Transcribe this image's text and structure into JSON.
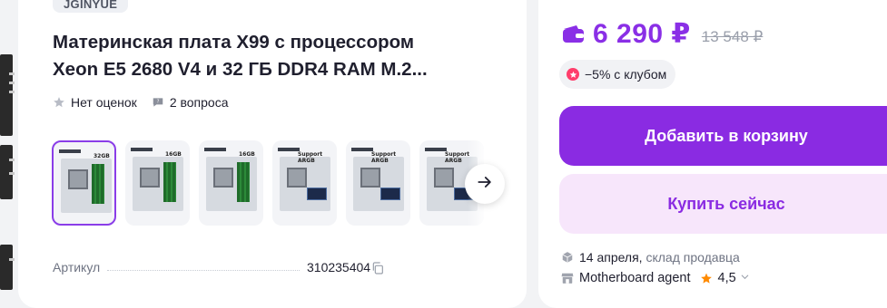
{
  "product": {
    "brand": "JGINYUE",
    "title_line1": "Материнская плата X99 с процессором",
    "title_line2": "Xeon E5 2680 V4 и 32 ГБ DDR4 RAM M.2...",
    "rating_text": "Нет оценок",
    "questions_text": "2 вопроса",
    "thumbnails": [
      {
        "label": "32GB"
      },
      {
        "label": "16GB"
      },
      {
        "label": "16GB"
      },
      {
        "label": "Support ARGB"
      },
      {
        "label": "Support ARGB"
      },
      {
        "label": "Support ARGB"
      }
    ],
    "spec": {
      "key": "Артикул",
      "value": "310235404"
    }
  },
  "pricing": {
    "price": "6 290 ₽",
    "old_price": "13 548 ₽",
    "club_discount": "−5% с клубом",
    "add_to_cart": "Добавить в корзину",
    "buy_now": "Купить сейчас",
    "delivery_date": "14 апреля,",
    "delivery_source": "склад продавца",
    "seller_name": "Motherboard agent",
    "seller_rating": "4,5"
  },
  "colors": {
    "accent": "#8a2be2",
    "accent_soft": "#f7e6fb",
    "star": "#ff8a00"
  }
}
